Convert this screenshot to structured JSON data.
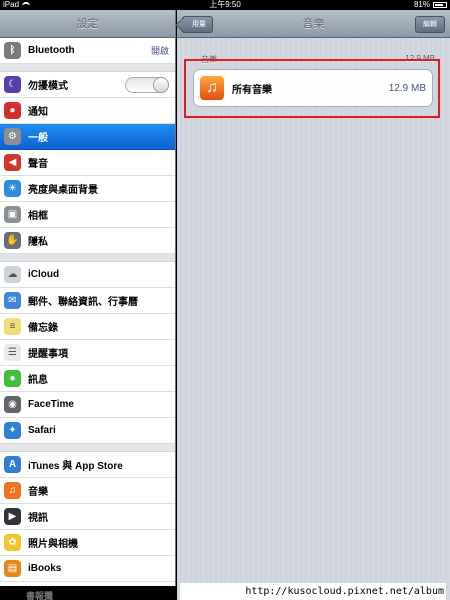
{
  "status_bar": {
    "carrier": "iPad",
    "time": "上午9:50",
    "battery": "81%",
    "battery_level": 0.81
  },
  "sidebar": {
    "title": "設定",
    "items": [
      {
        "label": "Bluetooth",
        "value": "開啟",
        "icon": "bluetooth-icon",
        "color": "#7a7a7a"
      },
      {
        "label": "勿擾模式",
        "icon": "moon-icon",
        "color": "#5a3ea8",
        "toggle": false
      },
      {
        "label": "通知",
        "icon": "notification-icon",
        "color": "#d12f2f"
      },
      {
        "label": "一般",
        "icon": "gear-icon",
        "color": "#8a8f96",
        "selected": true
      },
      {
        "label": "聲音",
        "icon": "speaker-icon",
        "color": "#d0362c"
      },
      {
        "label": "亮度與桌面背景",
        "icon": "brightness-icon",
        "color": "#2b8de0"
      },
      {
        "label": "相框",
        "icon": "frame-icon",
        "color": "#8a8f96"
      },
      {
        "label": "隱私",
        "icon": "hand-icon",
        "color": "#6a6f78"
      },
      {
        "label": "iCloud",
        "icon": "cloud-icon",
        "color": "#cdd3da"
      },
      {
        "label": "郵件、聯絡資訊、行事曆",
        "icon": "mail-icon",
        "color": "#3e86d8"
      },
      {
        "label": "備忘錄",
        "icon": "notes-icon",
        "color": "#f3dc7a"
      },
      {
        "label": "提醒事項",
        "icon": "reminders-icon",
        "color": "#e9e9e9"
      },
      {
        "label": "訊息",
        "icon": "message-icon",
        "color": "#3fbf3b"
      },
      {
        "label": "FaceTime",
        "icon": "facetime-icon",
        "color": "#606468"
      },
      {
        "label": "Safari",
        "icon": "compass-icon",
        "color": "#2f7fd4"
      },
      {
        "label": "iTunes 與 App Store",
        "icon": "appstore-icon",
        "color": "#2f7fd4"
      },
      {
        "label": "音樂",
        "icon": "music-icon",
        "color": "#f07320"
      },
      {
        "label": "視訊",
        "icon": "video-icon",
        "color": "#303438"
      },
      {
        "label": "照片與相機",
        "icon": "sunflower-icon",
        "color": "#f2c530"
      },
      {
        "label": "iBooks",
        "icon": "book-icon",
        "color": "#e08a20"
      }
    ],
    "partial_item": "書報攤"
  },
  "main": {
    "title": "音樂",
    "back_label": "用量",
    "edit_label": "編輯",
    "section_title": "音樂",
    "section_size": "12.9 MB",
    "cell_label": "所有音樂",
    "cell_size": "12.9 MB"
  },
  "watermark": "http://kusocloud.pixnet.net/album"
}
